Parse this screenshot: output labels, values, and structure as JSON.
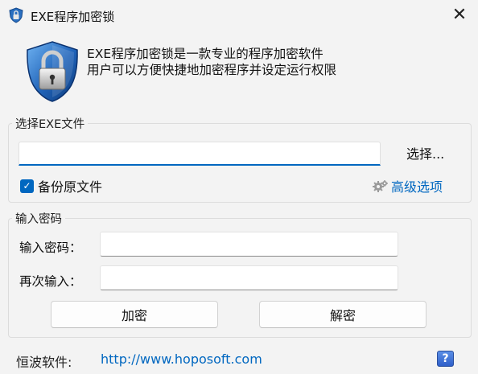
{
  "window": {
    "title": "EXE程序加密锁",
    "close_label": "✕"
  },
  "description": {
    "line1": "EXE程序加密锁是一款专业的程序加密软件",
    "line2": "用户可以方便快捷地加密程序并设定运行权限"
  },
  "exe_group": {
    "legend": "选择EXE文件",
    "file_path": "",
    "select_label": "选择...",
    "backup_label": "备份原文件",
    "backup_checked": true,
    "advanced_label": "高级选项"
  },
  "password_group": {
    "legend": "输入密码",
    "password_label": "输入密码：",
    "password_value": "",
    "confirm_label": "再次输入：",
    "confirm_value": ""
  },
  "buttons": {
    "encrypt": "加密",
    "decrypt": "解密"
  },
  "footer": {
    "label": "恒波软件:",
    "link": "http://www.hoposoft.com",
    "help": "?"
  },
  "colors": {
    "accent": "#0067c0",
    "background": "#f3f3f3"
  },
  "icons": {
    "app": "padlock-shield-icon",
    "logo": "padlock-shield-icon",
    "advanced": "gear-icon",
    "help": "help-icon"
  }
}
